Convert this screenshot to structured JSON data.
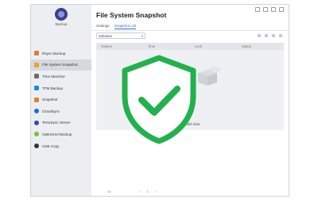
{
  "app": {
    "name": "Backup"
  },
  "sidebar": {
    "items": [
      {
        "label": "Rsync Backup",
        "color": "#e07b39"
      },
      {
        "label": "File System Snapshot",
        "color": "#f0a020",
        "active": true
      },
      {
        "label": "Time Machine",
        "color": "#6b6b6b"
      },
      {
        "label": "TFM Backup",
        "color": "#1e88e5"
      },
      {
        "label": "Snapshot",
        "color": "#d48a1c"
      },
      {
        "label": "CloudSync",
        "color": "#1b6fd1"
      },
      {
        "label": "TerraSync Server",
        "color": "#3b49a8"
      },
      {
        "label": "Optimized Backup",
        "color": "#7cc242"
      },
      {
        "label": "USB Copy",
        "color": "#333333"
      }
    ]
  },
  "main": {
    "title": "File System Snapshot",
    "tabs": [
      {
        "label": "Settings"
      },
      {
        "label": "Snapshot List",
        "active": true
      }
    ],
    "volume": "Volume1",
    "columns": [
      "Volume",
      "Time",
      "Lock",
      "Status"
    ],
    "empty_text": "No valid data.",
    "footer": {
      "count": "10",
      "page": "1"
    }
  },
  "overlay": {
    "icon": "shield-check-icon",
    "color": "#22b14c"
  }
}
